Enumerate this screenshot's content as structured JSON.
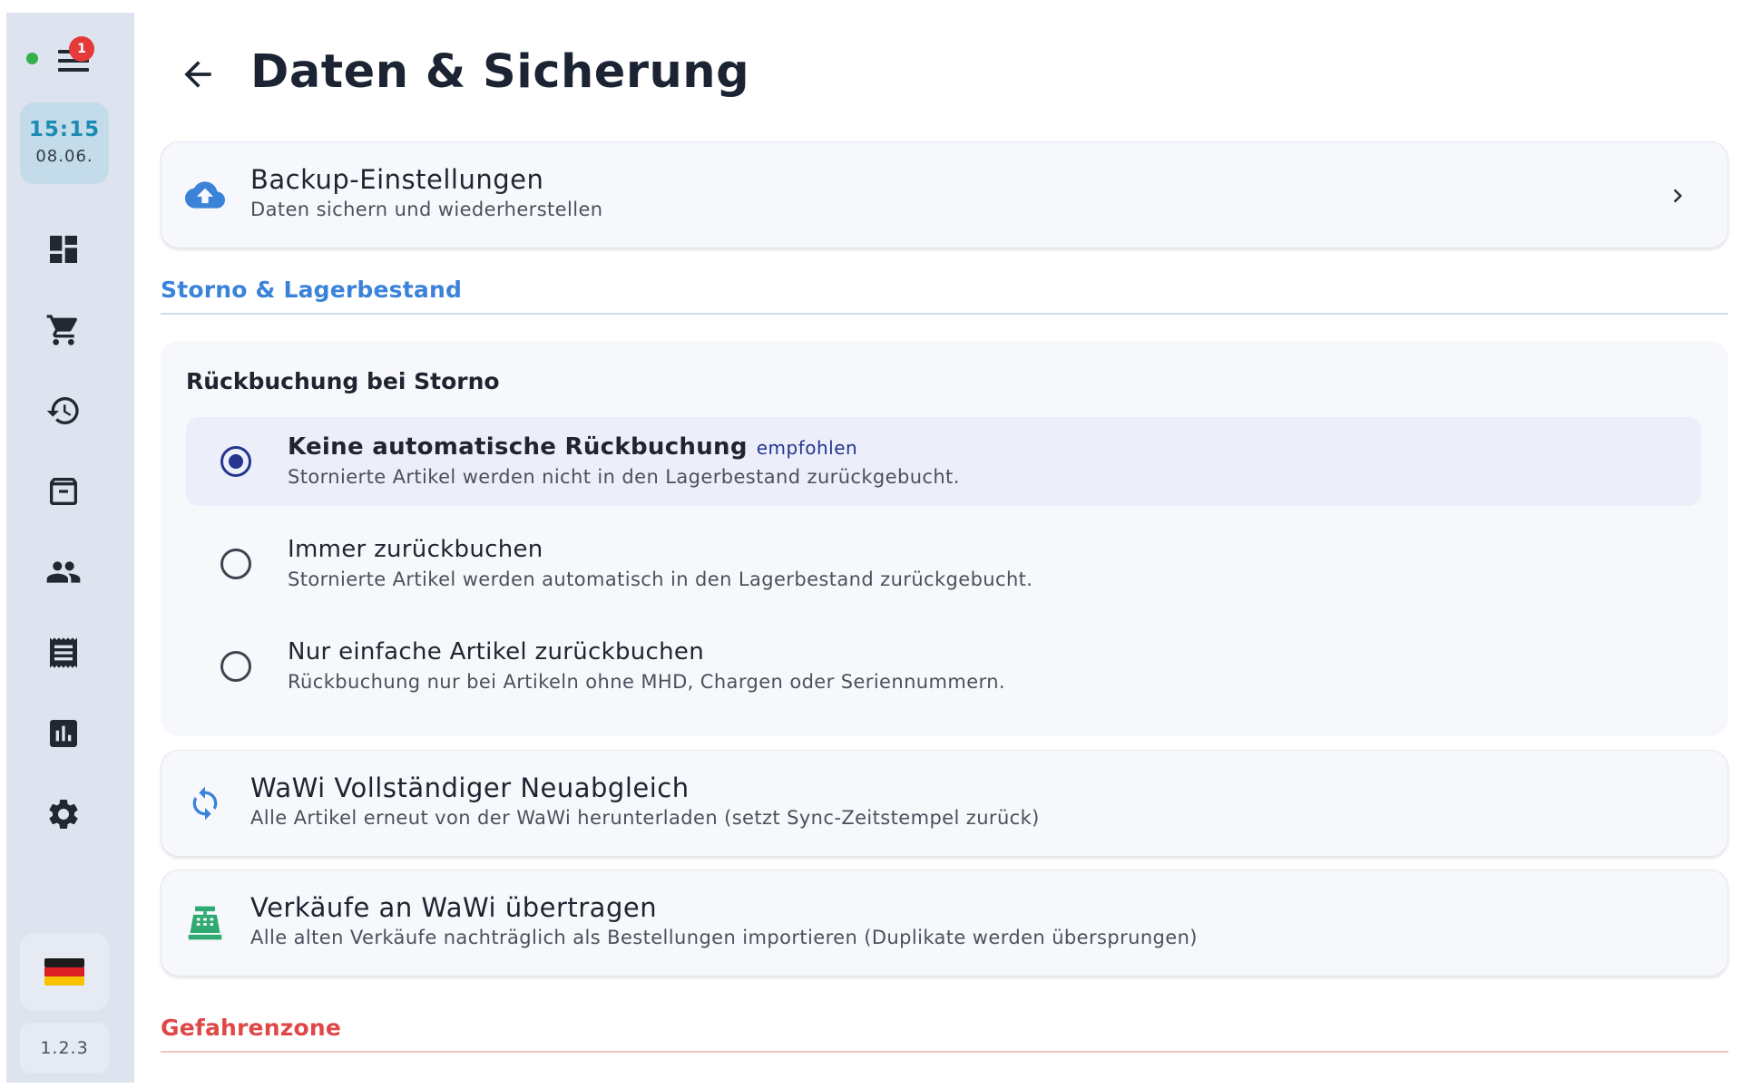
{
  "rail": {
    "notification_count": "1",
    "clock": {
      "time": "15:15",
      "date": "08.06."
    },
    "nav_items": [
      "dashboard-icon",
      "cart-icon",
      "history-icon",
      "archive-icon",
      "people-icon",
      "receipt-icon",
      "chart-icon",
      "gear-icon"
    ],
    "language_flag": "🇩🇪",
    "version": "1.2.3",
    "status_color": "#34b04a"
  },
  "header": {
    "title": "Daten & Sicherung"
  },
  "backup_card": {
    "title": "Backup-Einstellungen",
    "subtitle": "Daten sichern und wiederherstellen"
  },
  "storno_section": {
    "heading": "Storno & Lagerbestand",
    "group_title": "Rückbuchung bei Storno",
    "options": [
      {
        "title": "Keine automatische Rückbuchung",
        "badge": "empfohlen",
        "subtitle": "Stornierte Artikel werden nicht in den Lagerbestand zurückgebucht.",
        "selected": true
      },
      {
        "title": "Immer zurückbuchen",
        "subtitle": "Stornierte Artikel werden automatisch in den Lagerbestand zurückgebucht.",
        "selected": false
      },
      {
        "title": "Nur einfache Artikel zurückbuchen",
        "subtitle": "Rückbuchung nur bei Artikeln ohne MHD, Chargen oder Seriennummern.",
        "selected": false
      }
    ]
  },
  "resync_card": {
    "title": "WaWi Vollständiger Neuabgleich",
    "subtitle": "Alle Artikel erneut von der WaWi herunterladen (setzt Sync-Zeitstempel zurück)"
  },
  "transfer_card": {
    "title": "Verkäufe an WaWi übertragen",
    "subtitle": "Alle alten Verkäufe nachträglich als Bestellungen importieren (Duplikate werden übersprungen)"
  },
  "danger_section": {
    "heading": "Gefahrenzone"
  },
  "colors": {
    "accent_blue": "#3b82d9",
    "danger_red": "#e04848",
    "selected_radio": "#25358e",
    "transfer_icon": "#2eaa72"
  }
}
